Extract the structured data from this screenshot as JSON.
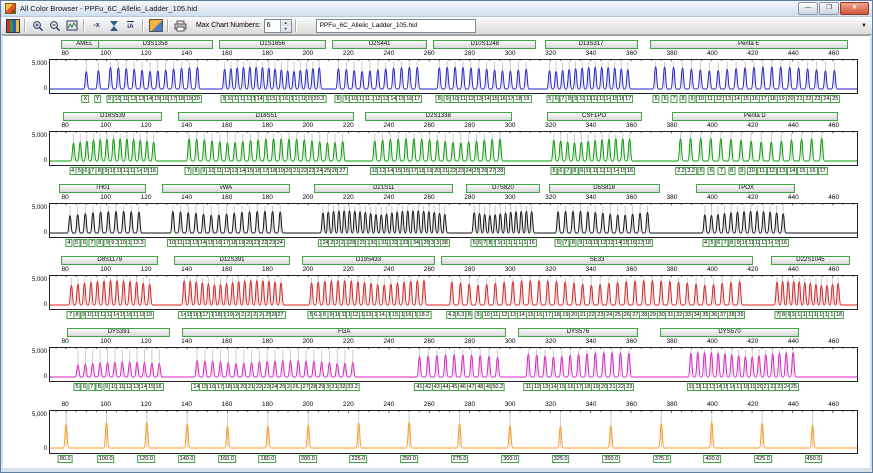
{
  "window": {
    "title": "All Color Browser - PPFu_6C_Allelic_Ladder_105.hid",
    "controls": {
      "minimize_glyph": "—",
      "maximize_glyph": "❐",
      "close_glyph": "✕"
    }
  },
  "toolbar": {
    "icons": [
      "color-browser-icon",
      "zoom-in-icon",
      "zoom-out-icon",
      "chart-zoom-icon",
      "remove-x-axis-icon",
      "full-scale-icon",
      "auto-label-icon",
      "capture-icon",
      "print-icon"
    ],
    "minus_x_glyph": "-x",
    "ia_glyph": "iA",
    "max_chart_label": "Max Chart Numbers:",
    "max_chart_value": "6",
    "spin_up": "▲",
    "spin_down": "▼",
    "file_tab": "PPFu_6C_Allelic_Ladder_105.hid",
    "overflow_glyph": "▼"
  },
  "axis": {
    "bp_min": 72,
    "bp_max": 472,
    "ticks": [
      80,
      100,
      120,
      140,
      160,
      180,
      200,
      220,
      240,
      260,
      280,
      300,
      320,
      340,
      360,
      380,
      400,
      420,
      440,
      460
    ],
    "y_max": "5,000",
    "y_zero": "0"
  },
  "rows": [
    {
      "channel": "blue",
      "color": "#2222cc",
      "headers": [
        {
          "name": "AMEL",
          "span": [
            78,
            100
          ]
        },
        {
          "name": "D3S1358",
          "span": [
            96,
            152
          ]
        },
        {
          "name": "D1S1656",
          "span": [
            156,
            208
          ]
        },
        {
          "name": "D2S441",
          "span": [
            212,
            258
          ]
        },
        {
          "name": "D10S1248",
          "span": [
            262,
            312
          ]
        },
        {
          "name": "D13S317",
          "span": [
            317,
            362
          ]
        },
        {
          "name": "Penta E",
          "span": [
            369,
            466
          ]
        }
      ],
      "groups": [
        {
          "span": [
            87,
            99
          ],
          "amp": 0.78,
          "alleles": [
            "X",
            "Y"
          ]
        },
        {
          "span": [
            100,
            147
          ],
          "amp": 0.78,
          "alleles": [
            "9",
            "10",
            "11",
            "12",
            "13",
            "14",
            "15",
            "16",
            "17",
            "18",
            "19",
            "20"
          ]
        },
        {
          "span": [
            157,
            207
          ],
          "amp": 0.78,
          "alleles": [
            "9",
            "10",
            "11",
            "12",
            "13",
            "14",
            "14.3",
            "15",
            "15.3",
            "16",
            "16.3",
            "17",
            "17.3",
            "18.3",
            "19.3",
            "20.3"
          ]
        },
        {
          "span": [
            213,
            256
          ],
          "amp": 0.78,
          "alleles": [
            "8",
            "9",
            "10",
            "11",
            "11.3",
            "12",
            "13",
            "14",
            "15",
            "16",
            "17"
          ]
        },
        {
          "span": [
            263,
            310
          ],
          "amp": 0.78,
          "alleles": [
            "8",
            "9",
            "10",
            "11",
            "12",
            "13",
            "14",
            "15",
            "16",
            "17",
            "18",
            "19"
          ]
        },
        {
          "span": [
            318,
            360
          ],
          "amp": 0.78,
          "alleles": [
            "5",
            "6",
            "7",
            "8",
            "9",
            "10",
            "11",
            "12",
            "13",
            "14",
            "15",
            "16",
            "17"
          ]
        },
        {
          "span": [
            370,
            463
          ],
          "amp": 0.8,
          "alleles": [
            "5",
            "6",
            "7",
            "8",
            "9",
            "10",
            "11",
            "12",
            "13",
            "14",
            "15",
            "16",
            "17",
            "18",
            "19",
            "20",
            "21",
            "22",
            "23",
            "24",
            "25"
          ]
        }
      ]
    },
    {
      "channel": "green",
      "color": "#00a000",
      "headers": [
        {
          "name": "D16S539",
          "span": [
            79,
            127
          ]
        },
        {
          "name": "D18S51",
          "span": [
            136,
            222
          ]
        },
        {
          "name": "D2S1338",
          "span": [
            228,
            300
          ]
        },
        {
          "name": "CSF1PO",
          "span": [
            318,
            364
          ]
        },
        {
          "name": "Penta D",
          "span": [
            380,
            461
          ]
        }
      ],
      "groups": [
        {
          "span": [
            82,
            125
          ],
          "amp": 0.8,
          "alleles": [
            "4",
            "5",
            "6",
            "7",
            "8",
            "9",
            "10",
            "11",
            "12",
            "13",
            "14",
            "15",
            "16"
          ]
        },
        {
          "span": [
            139,
            219
          ],
          "amp": 0.8,
          "alleles": [
            "7",
            "8",
            "9",
            "10",
            "11",
            "12",
            "13",
            "14",
            "15",
            "16",
            "17",
            "18",
            "19",
            "20",
            "21",
            "22",
            "23",
            "24",
            "25",
            "26",
            "27"
          ]
        },
        {
          "span": [
            231,
            297
          ],
          "amp": 0.8,
          "alleles": [
            "10",
            "12",
            "14",
            "15",
            "16",
            "17",
            "18",
            "19",
            "20",
            "21",
            "22",
            "23",
            "24",
            "25",
            "26",
            "27",
            "28"
          ]
        },
        {
          "span": [
            320,
            361
          ],
          "amp": 0.8,
          "alleles": [
            "5",
            "6",
            "7",
            "8",
            "9",
            "10",
            "11",
            "12",
            "13",
            "14",
            "15",
            "16"
          ]
        },
        {
          "span": [
            382,
            457
          ],
          "amp": 0.82,
          "alleles": [
            "2.2",
            "3.2",
            "5",
            "6",
            "7",
            "8",
            "9",
            "10",
            "11",
            "12",
            "13",
            "14",
            "15",
            "16",
            "17"
          ]
        }
      ]
    },
    {
      "channel": "black",
      "color": "#111111",
      "headers": [
        {
          "name": "TH01",
          "span": [
            77,
            119
          ]
        },
        {
          "name": "vWA",
          "span": [
            128,
            190
          ]
        },
        {
          "name": "D21S11",
          "span": [
            203,
            271
          ]
        },
        {
          "name": "D7S820",
          "span": [
            278,
            314
          ]
        },
        {
          "name": "D5S818",
          "span": [
            319,
            373
          ]
        },
        {
          "name": "TPOX",
          "span": [
            392,
            440
          ]
        }
      ],
      "groups": [
        {
          "span": [
            80,
            118
          ],
          "amp": 0.78,
          "alleles": [
            "4",
            "5",
            "6",
            "7",
            "8",
            "9",
            "9.3",
            "10",
            "11",
            "13.3"
          ]
        },
        {
          "span": [
            131,
            188
          ],
          "amp": 0.78,
          "alleles": [
            "10",
            "11",
            "12",
            "13",
            "14",
            "15",
            "16",
            "17",
            "18",
            "19",
            "20",
            "21",
            "22",
            "23",
            "24"
          ]
        },
        {
          "span": [
            206,
            269
          ],
          "amp": 0.8,
          "alleles": [
            "24",
            "24.2",
            "25",
            "26",
            "27",
            "28",
            "28.2",
            "29",
            "29.2",
            "30",
            "30.2",
            "31",
            "31.2",
            "32",
            "32.2",
            "33",
            "33.2",
            "34",
            "34.2",
            "35",
            "35.2",
            "36",
            "37",
            "38"
          ]
        },
        {
          "span": [
            281,
            312
          ],
          "amp": 0.78,
          "alleles": [
            "5",
            "6",
            "7",
            "8",
            "9",
            "10",
            "11",
            "12",
            "13",
            "14",
            "15",
            "16"
          ]
        },
        {
          "span": [
            322,
            370
          ],
          "amp": 0.78,
          "alleles": [
            "6",
            "7",
            "8",
            "9",
            "10",
            "11",
            "12",
            "13",
            "14",
            "15",
            "16",
            "17",
            "18"
          ]
        },
        {
          "span": [
            395,
            437
          ],
          "amp": 0.78,
          "alleles": [
            "4",
            "5",
            "6",
            "7",
            "8",
            "9",
            "10",
            "11",
            "12",
            "13",
            "14",
            "15",
            "16"
          ]
        }
      ]
    },
    {
      "channel": "red",
      "color": "#dd2020",
      "headers": [
        {
          "name": "D8S1179",
          "span": [
            78,
            125
          ]
        },
        {
          "name": "D12S391",
          "span": [
            134,
            190
          ]
        },
        {
          "name": "D19S433",
          "span": [
            197,
            262
          ]
        },
        {
          "name": "SE33",
          "span": [
            266,
            419
          ]
        },
        {
          "name": "D22S1045",
          "span": [
            429,
            467
          ]
        }
      ],
      "groups": [
        {
          "span": [
            81,
            123
          ],
          "amp": 0.88,
          "alleles": [
            "7",
            "8",
            "9",
            "10",
            "11",
            "12",
            "13",
            "14",
            "15",
            "16",
            "17",
            "18",
            "19"
          ]
        },
        {
          "span": [
            137,
            188
          ],
          "amp": 0.88,
          "alleles": [
            "14",
            "15",
            "16",
            "17",
            "17.3",
            "18",
            "18.3",
            "19",
            "19.3",
            "20",
            "21",
            "22",
            "23",
            "24",
            "25",
            "26",
            "27"
          ]
        },
        {
          "span": [
            200,
            259
          ],
          "amp": 0.88,
          "alleles": [
            "5",
            "6.2",
            "8",
            "9",
            "10",
            "11",
            "12",
            "12.2",
            "13",
            "13.2",
            "14",
            "14.2",
            "15",
            "15.2",
            "16",
            "16.2",
            "17",
            "18.2"
          ]
        },
        {
          "span": [
            269,
            416
          ],
          "amp": 0.88,
          "alleles": [
            "4.2",
            "6.3",
            "8",
            "9",
            "10",
            "11",
            "12",
            "13",
            "14",
            "15",
            "16",
            "17",
            "18",
            "19",
            "20",
            "21",
            "22",
            "23",
            "24",
            "25",
            "26",
            "27",
            "28",
            "29",
            "30",
            "31",
            "32",
            "33",
            "34",
            "35",
            "36",
            "37",
            "38",
            "39"
          ]
        },
        {
          "span": [
            431,
            464
          ],
          "amp": 0.85,
          "alleles": [
            "7",
            "8",
            "9",
            "10",
            "11",
            "12",
            "13",
            "14",
            "15",
            "16",
            "17",
            "18"
          ]
        }
      ]
    },
    {
      "channel": "magenta",
      "color": "#dd22c4",
      "headers": [
        {
          "name": "DYS391",
          "span": [
            81,
            131
          ]
        },
        {
          "name": "FGA",
          "span": [
            138,
            297
          ]
        },
        {
          "name": "DYS576",
          "span": [
            304,
            362
          ]
        },
        {
          "name": "DYS570",
          "span": [
            374,
            442
          ]
        }
      ],
      "groups": [
        {
          "span": [
            84,
            128
          ],
          "amp": 0.55,
          "alleles": [
            "5",
            "6",
            "7",
            "8",
            "9",
            "10",
            "11",
            "12",
            "13",
            "14",
            "15",
            "16"
          ]
        },
        {
          "span": [
            143,
            224
          ],
          "amp": 0.6,
          "alleles": [
            "14",
            "15",
            "16",
            "17",
            "18",
            "19",
            "20",
            "21",
            "22",
            "23",
            "24",
            "25",
            "26",
            "26.2",
            "27",
            "28",
            "29",
            "30",
            "31.2",
            "32.2",
            "33.2"
          ]
        },
        {
          "span": [
            253,
            296
          ],
          "amp": 0.8,
          "alleles": [
            "41",
            "42",
            "43",
            "44",
            "45",
            "46",
            "47",
            "48",
            "49",
            "50.2"
          ]
        },
        {
          "span": [
            307,
            361
          ],
          "amp": 0.88,
          "alleles": [
            "11",
            "12",
            "13",
            "14",
            "15",
            "16",
            "17",
            "18",
            "19",
            "20",
            "21",
            "22",
            "23"
          ]
        },
        {
          "span": [
            388,
            442
          ],
          "amp": 0.88,
          "alleles": [
            "10",
            "11",
            "12",
            "13",
            "14",
            "15",
            "16",
            "17",
            "18",
            "19",
            "20",
            "21",
            "22",
            "23",
            "24",
            "25"
          ]
        }
      ]
    },
    {
      "channel": "orange-ils",
      "color": "#ff9a1e",
      "tall": true,
      "groups": [
        {
          "amp": 0.72,
          "positions": [
            80,
            100,
            120,
            140,
            160,
            180,
            200,
            225,
            250,
            275,
            300,
            325,
            350,
            375,
            400,
            425,
            450
          ],
          "labels": [
            "80.0",
            "100.0",
            "120.0",
            "140.0",
            "160.0",
            "180.0",
            "200.0",
            "225.0",
            "250.0",
            "275.0",
            "300.0",
            "325.0",
            "350.0",
            "375.0",
            "400.0",
            "425.0",
            "450.0"
          ]
        }
      ]
    }
  ]
}
